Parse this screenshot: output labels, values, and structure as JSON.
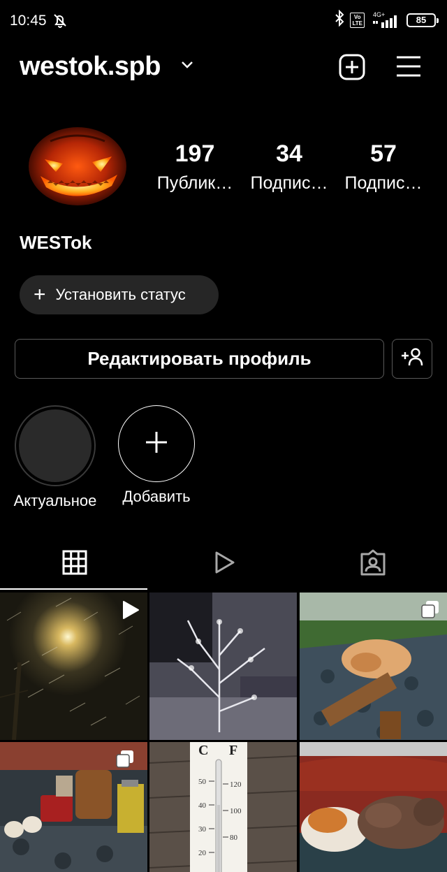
{
  "status_bar": {
    "time": "10:45",
    "network_label": "4G+",
    "volte_top": "Vo",
    "volte_bottom": "LTE",
    "battery": "85"
  },
  "header": {
    "username": "westok.spb"
  },
  "profile": {
    "display_name": "WESTok",
    "stats": [
      {
        "value": "197",
        "label": "Публик…"
      },
      {
        "value": "34",
        "label": "Подпис…"
      },
      {
        "value": "57",
        "label": "Подпис…"
      }
    ],
    "status_button": "Установить статус",
    "edit_button": "Редактировать профиль"
  },
  "highlights": [
    {
      "label": "Актуальное"
    },
    {
      "label": "Добавить"
    }
  ],
  "tabs": [
    {
      "icon": "grid-icon",
      "active": true
    },
    {
      "icon": "reels-icon",
      "active": false
    },
    {
      "icon": "tagged-icon",
      "active": false
    }
  ],
  "posts": [
    {
      "subject": "night snowfall street light",
      "badge": "reel-play-icon"
    },
    {
      "subject": "frosted tree in snow",
      "badge": ""
    },
    {
      "subject": "table with dried flowers in greenhouse",
      "badge": "carousel-icon"
    },
    {
      "subject": "jars and garlic on table",
      "badge": "carousel-icon"
    },
    {
      "subject": "thermometer celsius fahrenheit",
      "badge": ""
    },
    {
      "subject": "sleeping cats",
      "badge": ""
    }
  ],
  "thermometer": {
    "c_label": "C",
    "f_label": "F",
    "c_ticks": [
      "50",
      "40",
      "30",
      "20"
    ],
    "f_ticks": [
      "120",
      "100",
      "80"
    ]
  }
}
